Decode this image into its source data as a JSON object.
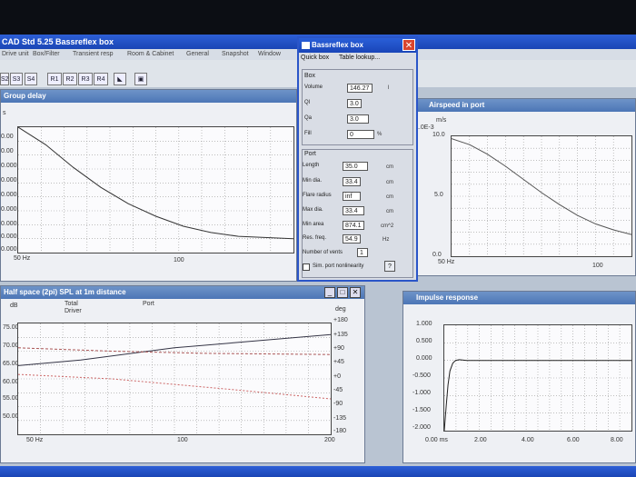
{
  "app": {
    "title": "CAD Std 5.25 Bassreflex box"
  },
  "menu": [
    "Drive unit",
    "Box/Filter",
    "Transient resp",
    "Room & Cabinet",
    "General",
    "Snapshot",
    "Window"
  ],
  "toolbar": [
    "S2",
    "S3",
    "S4",
    "R1",
    "R2",
    "R3",
    "R4"
  ],
  "group_delay": {
    "title": "Group delay",
    "unit": "s",
    "yticks": [
      "0.00",
      "0.00",
      "0.000",
      "0.000",
      "0.000",
      "0.000",
      "0.000",
      "0.000",
      "0.000"
    ],
    "xticks": [
      "50 Hz",
      "100"
    ],
    "curve": [
      [
        0,
        0.0
      ],
      [
        0.1,
        0.14
      ],
      [
        0.2,
        0.32
      ],
      [
        0.3,
        0.48
      ],
      [
        0.4,
        0.61
      ],
      [
        0.5,
        0.71
      ],
      [
        0.6,
        0.79
      ],
      [
        0.7,
        0.84
      ],
      [
        0.8,
        0.87
      ],
      [
        1.0,
        0.89
      ]
    ]
  },
  "dialog": {
    "title": "Bassreflex box",
    "menu": [
      "Quick box",
      "Table lookup..."
    ],
    "box_label": "Box",
    "volume_label": "Volume",
    "volume": "146.27",
    "volume_unit": "l",
    "ql_label": "Ql",
    "ql": "3.0",
    "qa_label": "Qa",
    "qa": "3.0",
    "fill_label": "Fill",
    "fill": "0",
    "fill_unit": "%",
    "port_label": "Port",
    "length_label": "Length",
    "length": "35.0",
    "length_unit": "cm",
    "mindia_label": "Min dia.",
    "mindia": "33.4",
    "mindia_unit": "cm",
    "flare_label": "Flare radius",
    "flare": "inf",
    "flare_unit": "cm",
    "maxdia_label": "Max dia.",
    "maxdia": "33.4",
    "maxdia_unit": "cm",
    "minarea_label": "Min area",
    "minarea": "874.1",
    "minarea_unit": "cm^2",
    "resfreq_label": "Res. freq.",
    "resfreq": "54.9",
    "resfreq_unit": "Hz",
    "vents_label": "Number of vents",
    "vents": "1",
    "sim_label": "Sim. port nonlinearity",
    "help": "?"
  },
  "airspeed": {
    "title": "Airspeed in port",
    "unit": "m/s",
    "scale": "1.0E-3",
    "yticks": [
      "10.0",
      "5.0",
      "0.0"
    ],
    "xticks": [
      "50 Hz",
      "100"
    ],
    "ylim": [
      0,
      10
    ],
    "curve": [
      [
        0,
        9.8
      ],
      [
        0.1,
        9.3
      ],
      [
        0.2,
        8.5
      ],
      [
        0.3,
        7.5
      ],
      [
        0.4,
        6.4
      ],
      [
        0.5,
        5.3
      ],
      [
        0.6,
        4.3
      ],
      [
        0.7,
        3.4
      ],
      [
        0.8,
        2.7
      ],
      [
        0.9,
        2.2
      ],
      [
        1.0,
        1.8
      ]
    ]
  },
  "spl": {
    "title": "Half space (2pi) SPL at 1m distance",
    "ylabel": "dB",
    "rlabel": "deg",
    "legend": [
      "Total",
      "Driver",
      "Port"
    ],
    "yticks": [
      "75.00",
      "70.00",
      "65.00",
      "60.00",
      "55.00",
      "50.00"
    ],
    "rticks": [
      "+180",
      "+135",
      "+90",
      "+45",
      "+0",
      "-45",
      "-90",
      "-135",
      "-180"
    ],
    "xticks": [
      "50 Hz",
      "100",
      "200"
    ]
  },
  "impulse": {
    "title": "Impulse response",
    "yticks": [
      "1.000",
      "0.500",
      "0.000",
      "-0.500",
      "-1.000",
      "-1.500",
      "-2.000"
    ],
    "xticks": [
      "0.00 ms",
      "2.00",
      "4.00",
      "6.00",
      "8.00"
    ],
    "ylim": [
      -2.0,
      1.0
    ],
    "curve": [
      [
        0,
        -2.0
      ],
      [
        0.01,
        -1.3
      ],
      [
        0.02,
        -0.7
      ],
      [
        0.03,
        -0.3
      ],
      [
        0.045,
        -0.08
      ],
      [
        0.06,
        0.0
      ],
      [
        0.08,
        0.02
      ],
      [
        0.12,
        0.0
      ],
      [
        0.2,
        0.0
      ],
      [
        1.0,
        0.0
      ]
    ]
  }
}
